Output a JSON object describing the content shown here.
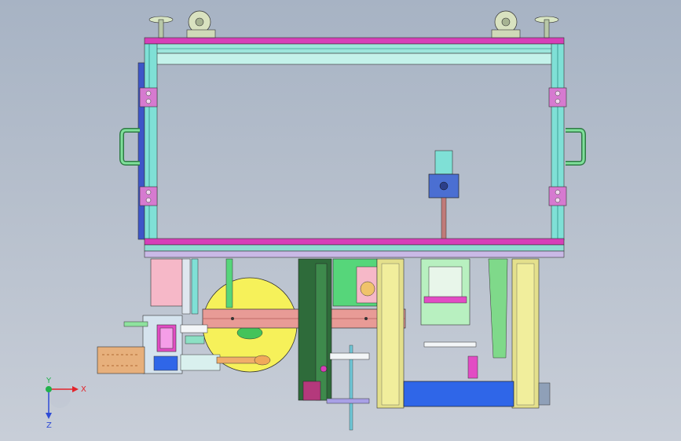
{
  "window": {
    "title": ""
  },
  "viewport": {
    "background_top": "#a7b3c4",
    "background_bottom": "#c8ced8"
  },
  "triad": {
    "x_label": "X",
    "y_label": "Y",
    "z_label": "Z",
    "x_color": "#e3242b",
    "y_color": "#22b14c",
    "z_color": "#2e4bd6"
  },
  "model": {
    "name": "",
    "colors": {
      "frame_cyan": "#7fe0d6",
      "frame_magenta": "#d63fb8",
      "plate_yellow": "#f6f15a",
      "base_blue": "#2f66e8",
      "motor_blue": "#4b6fd2",
      "dark_green": "#2e6b3a",
      "handle_green": "#56d67a",
      "pink_block": "#f6b8c8",
      "slide_rail": "#d6a36b",
      "leg_yellow": "#e4e08c"
    }
  }
}
